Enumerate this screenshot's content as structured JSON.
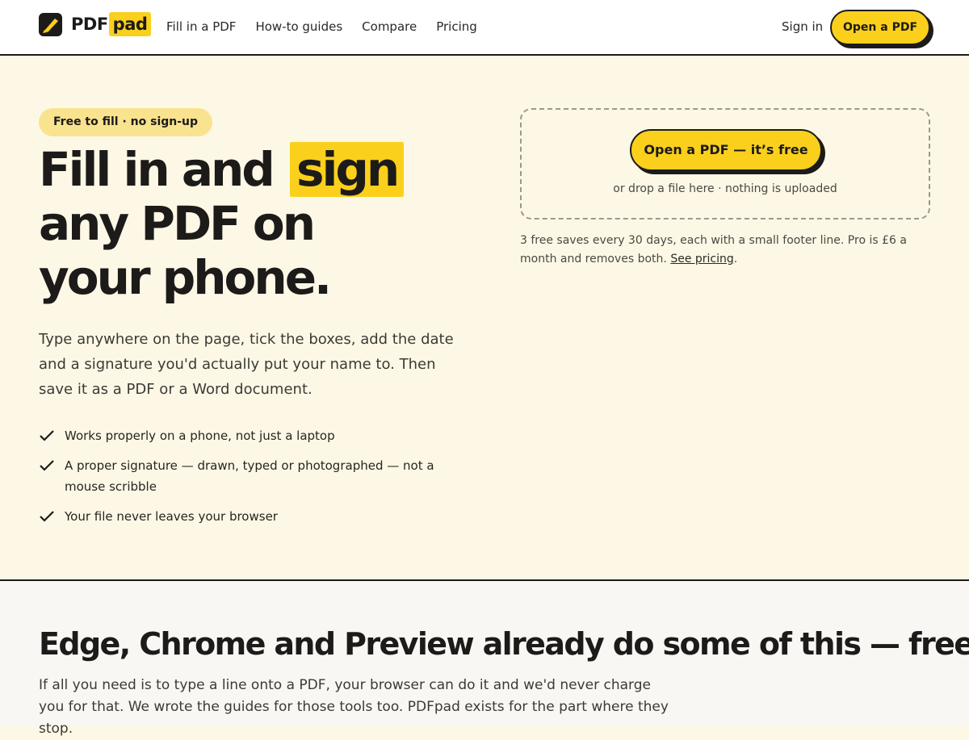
{
  "header": {
    "logo": {
      "part1": "PDF",
      "part2": "pad"
    },
    "nav": [
      "Fill in a PDF",
      "How-to guides",
      "Compare",
      "Pricing"
    ],
    "signin": "Sign in",
    "cta": "Open a PDF"
  },
  "hero": {
    "pill": "Free to fill · no sign-up",
    "headline": {
      "line1_pre": "Fill in and",
      "line1_mark": "sign",
      "line2": "any PDF on",
      "line3": "your phone."
    },
    "lead": "Type anywhere on the page, tick the boxes, add the date and a signature you'd actually put your name to. Then save it as a PDF or a Word document.",
    "checks": [
      "Works properly on a phone, not just a laptop",
      "A proper signature — drawn, typed or photographed — not a mouse scribble",
      "Your file never leaves your browser"
    ]
  },
  "dropzone": {
    "button": "Open a PDF — it’s free",
    "note": "or drop a file here · nothing is uploaded"
  },
  "pricing_note": {
    "text": "3 free saves every 30 days, each with a small footer line. Pro is £6 a month and removes both.",
    "link": "See pricing",
    "tail": "."
  },
  "compare": {
    "title": "Edge, Chrome and Preview already do some of this — free",
    "body": "If all you need is to type a line onto a PDF, your browser can do it and we'd never charge you for that. We wrote the guides for those tools too. PDFpad exists for the part where they stop."
  },
  "colors": {
    "accent": "#fad01c",
    "ink": "#1c1b19",
    "hero_bg": "#fdf8e6",
    "pill_bg": "#fae38e"
  },
  "icons": {
    "logo": "pen-nib-icon",
    "check": "check-icon"
  }
}
